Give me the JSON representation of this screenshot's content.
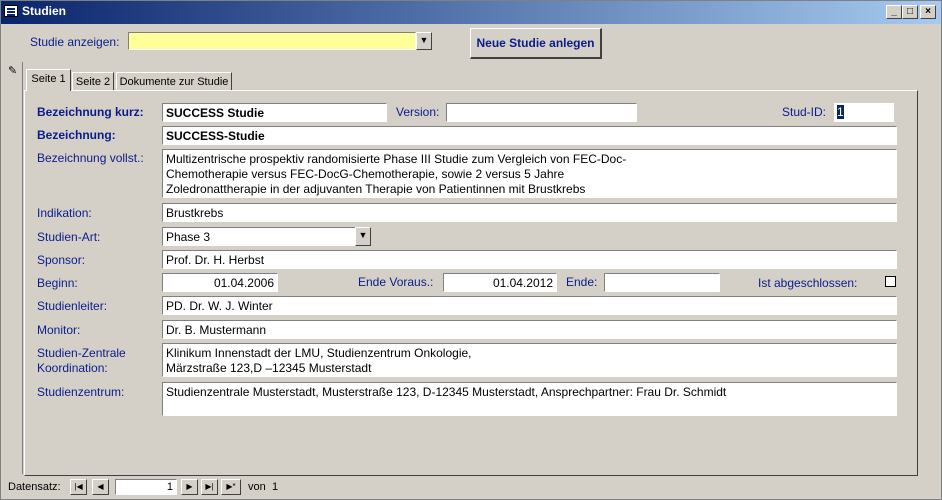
{
  "window": {
    "title": "Studien",
    "minimize": "_",
    "maximize": "□",
    "close": "×"
  },
  "toolbar": {
    "studie_label": "Studie anzeigen:",
    "studie_value": "",
    "new_button": "Neue Studie anlegen"
  },
  "tabs": [
    {
      "label": "Seite 1"
    },
    {
      "label": "Seite 2"
    },
    {
      "label": "Dokumente zur Studie"
    }
  ],
  "form": {
    "bez_kurz_label": "Bezeichnung kurz:",
    "bez_kurz_value": "SUCCESS Studie",
    "version_label": "Version:",
    "version_value": "",
    "studid_label": "Stud-ID:",
    "studid_value": "1",
    "bez_label": "Bezeichnung:",
    "bez_value": "SUCCESS-Studie",
    "bez_voll_label": "Bezeichnung vollst.:",
    "bez_voll_value": "Multizentrische prospektiv randomisierte Phase III Studie zum Vergleich von FEC-Doc-\nChemotherapie versus FEC-DocG-Chemotherapie, sowie 2 versus 5 Jahre\nZoledronattherapie in der adjuvanten Therapie von Patientinnen mit Brustkrebs",
    "indikation_label": "Indikation:",
    "indikation_value": "Brustkrebs",
    "art_label": "Studien-Art:",
    "art_value": "Phase 3",
    "sponsor_label": "Sponsor:",
    "sponsor_value": "Prof. Dr. H. Herbst",
    "beginn_label": "Beginn:",
    "beginn_value": "01.04.2006",
    "ende_voraus_label": "Ende Voraus.:",
    "ende_voraus_value": "01.04.2012",
    "ende_label": "Ende:",
    "ende_value": "",
    "abgeschlossen_label": "Ist abgeschlossen:",
    "leiter_label": "Studienleiter:",
    "leiter_value": "PD. Dr. W. J. Winter",
    "monitor_label": "Monitor:",
    "monitor_value": "Dr. B. Mustermann",
    "zentrale_label_1": "Studien-Zentrale",
    "zentrale_label_2": "Koordination:",
    "zentrale_value": "Klinikum Innenstadt der LMU, Studienzentrum Onkologie,\nMärzstraße 123,D –12345 Musterstadt",
    "zentrum_label": "Studienzentrum:",
    "zentrum_value": "Studienzentrale Musterstadt, Musterstraße 123, D-12345 Musterstadt, Ansprechpartner: Frau Dr. Schmidt"
  },
  "navigation": {
    "label": "Datensatz:",
    "current": "1",
    "of_label": "von",
    "total": "1"
  }
}
